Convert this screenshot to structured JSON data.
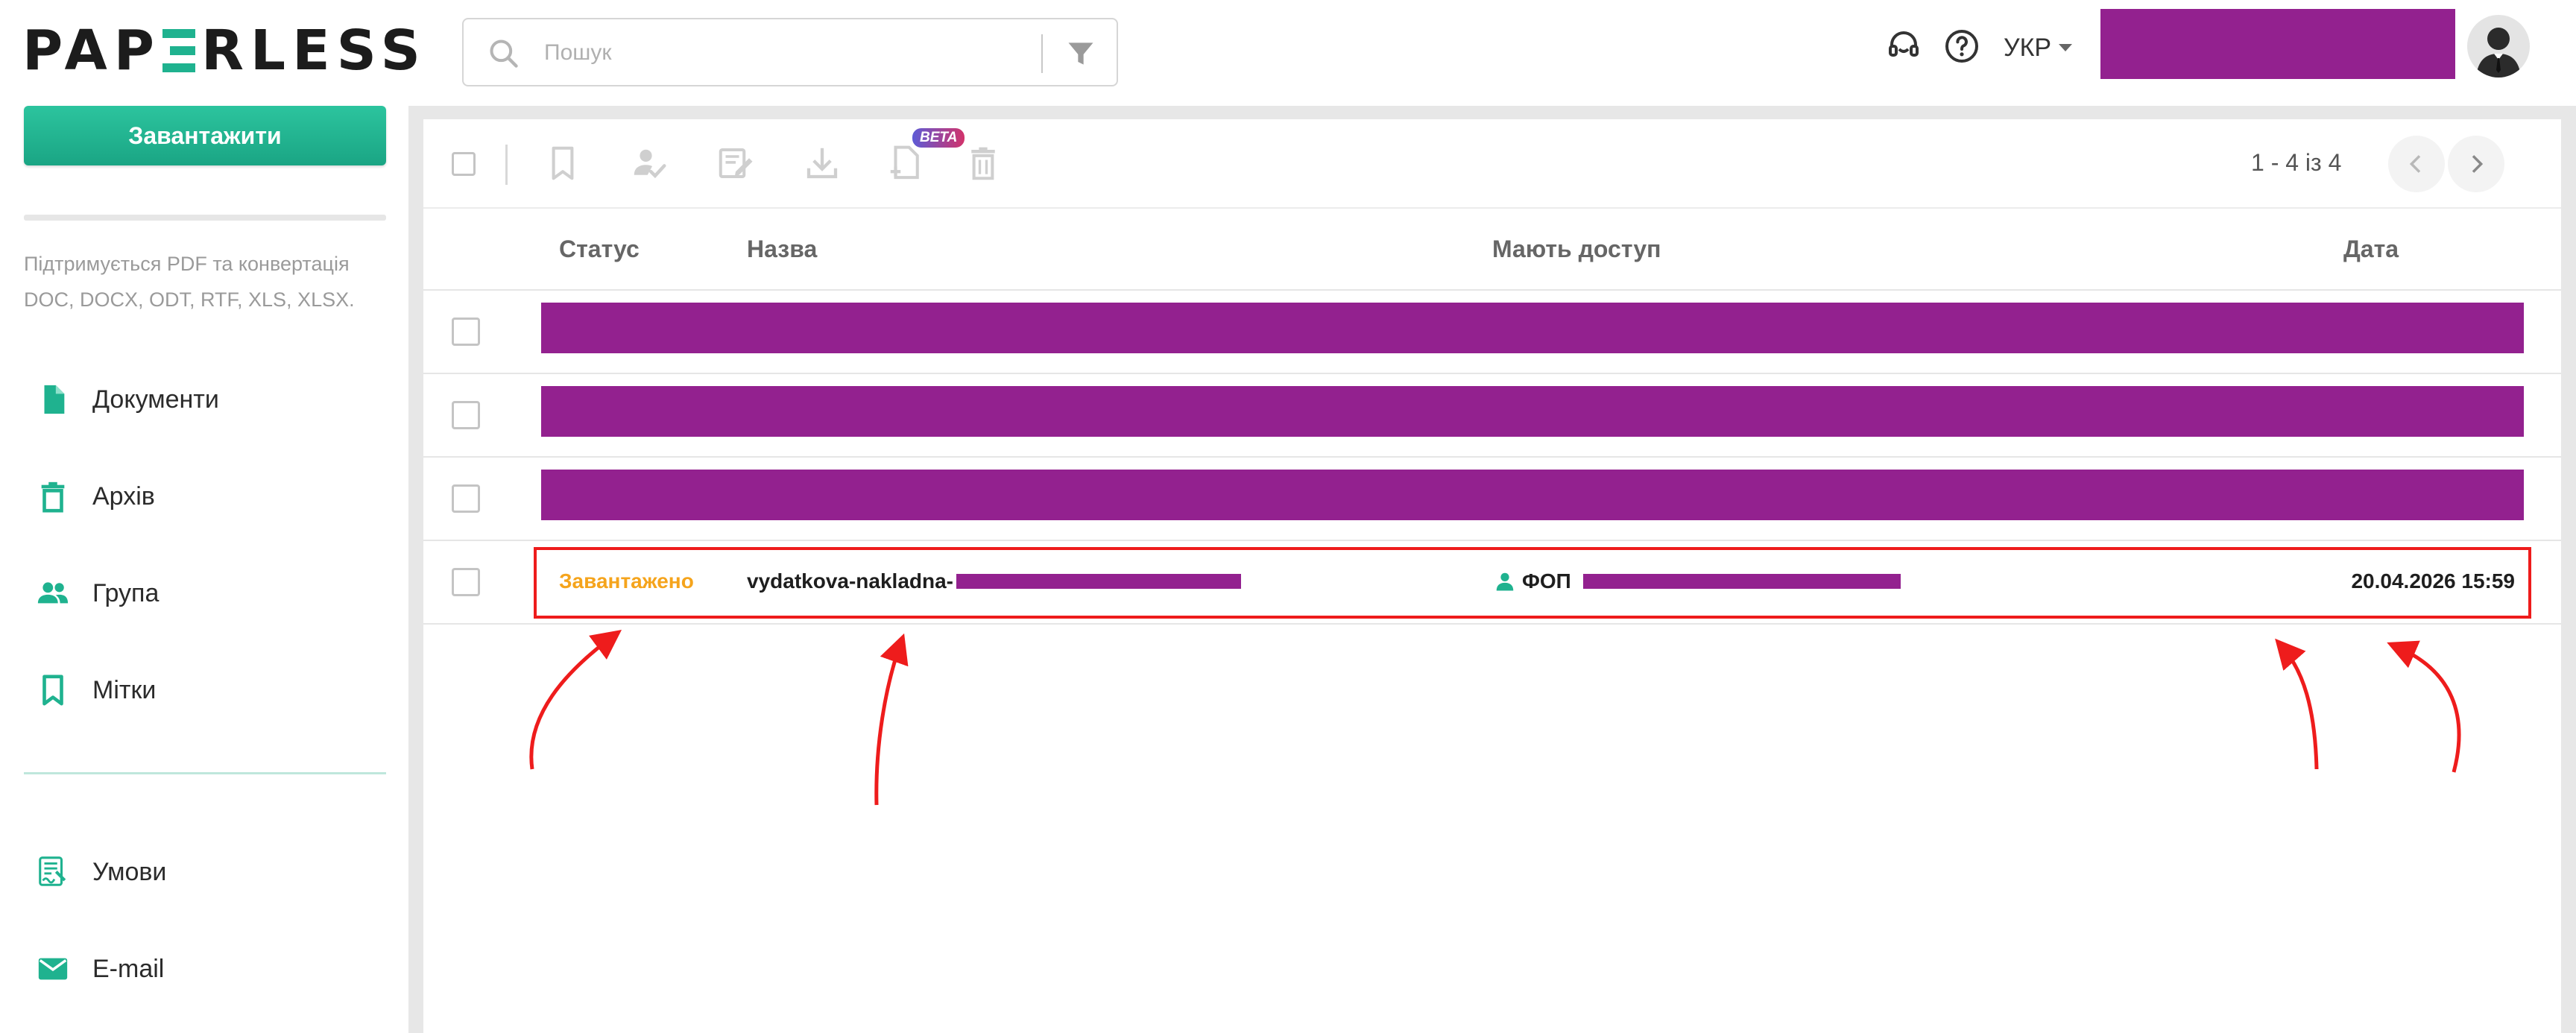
{
  "header": {
    "logo_text_start": "PAP",
    "logo_text_end": "RLESS",
    "search": {
      "placeholder": "Пошук",
      "value": ""
    },
    "language": "УКР"
  },
  "sidebar": {
    "upload_label": "Завантажити",
    "formats_hint": "Підтримується PDF та конвертація DOC, DOCX, ODT, RTF, XLS, XLSX.",
    "items": [
      {
        "label": "Документи",
        "icon": "document-icon"
      },
      {
        "label": "Архів",
        "icon": "trash-icon"
      },
      {
        "label": "Група",
        "icon": "group-icon"
      },
      {
        "label": "Мітки",
        "icon": "bookmark-icon"
      }
    ],
    "bottom_items": [
      {
        "label": "Умови",
        "icon": "terms-icon"
      },
      {
        "label": "E-mail",
        "icon": "mail-icon"
      }
    ]
  },
  "toolbar": {
    "beta_label": "BETA",
    "pagination": "1 - 4 із 4"
  },
  "table": {
    "columns": {
      "status": "Статус",
      "name": "Назва",
      "access": "Мають доступ",
      "date": "Дата"
    },
    "highlighted_row": {
      "status": "Завантажено",
      "name": "vydatkova-nakladna-",
      "access": "ФОП",
      "date": "20.04.2026 15:59"
    }
  },
  "colors": {
    "accent": "#1fb28f",
    "redaction": "#93218f",
    "status_uploaded": "#f5a41c",
    "annotation_red": "#ee1c1c"
  }
}
